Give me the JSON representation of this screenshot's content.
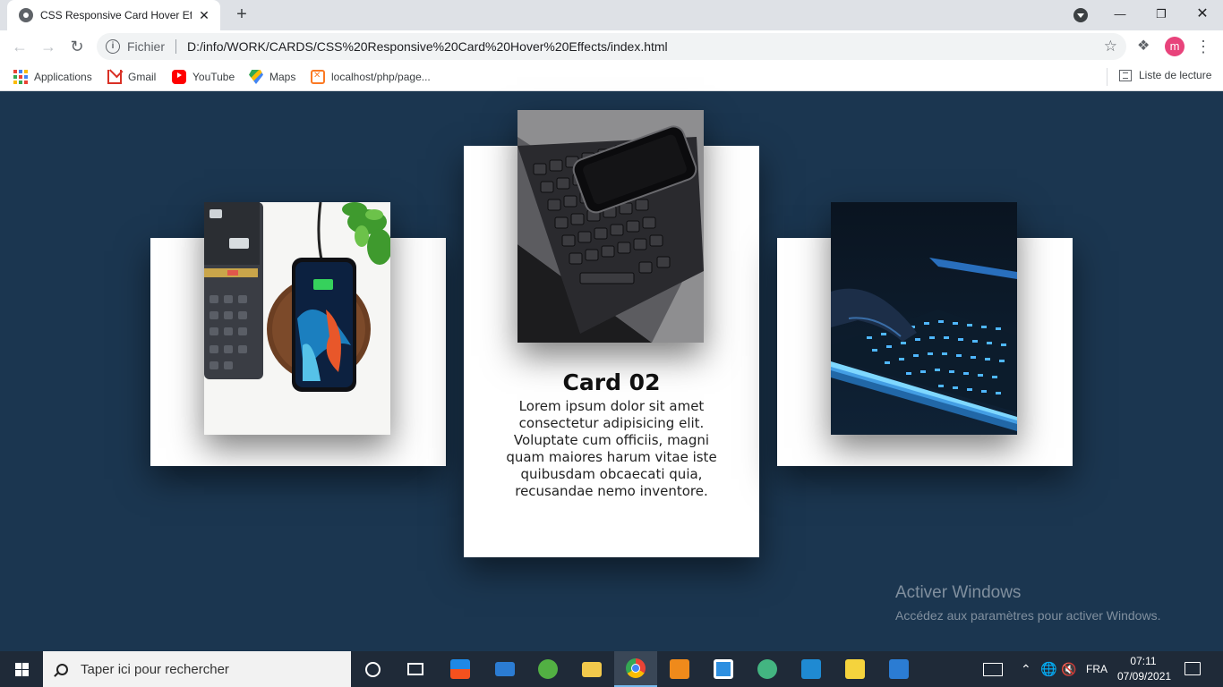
{
  "browser": {
    "tab_title": "CSS Responsive Card Hover Effects",
    "tab_close": "✕",
    "new_tab": "+",
    "url_scheme": "Fichier",
    "url": "D:/info/WORK/CARDS/CSS%20Responsive%20Card%20Hover%20Effects/index.html",
    "profile_initial": "m",
    "bookmarks": [
      {
        "label": "Applications",
        "icon": "apps-grid-icon"
      },
      {
        "label": "Gmail",
        "icon": "gmail-icon"
      },
      {
        "label": "YouTube",
        "icon": "youtube-icon"
      },
      {
        "label": "Maps",
        "icon": "maps-icon"
      },
      {
        "label": "localhost/php/page...",
        "icon": "xampp-icon"
      }
    ],
    "reading_list": "Liste de lecture"
  },
  "cards": [
    {
      "title": "",
      "text": "",
      "image": "phone-on-wireless-charger-photo"
    },
    {
      "title": "Card 02",
      "text": "Lorem ipsum dolor sit amet consectetur adipisicing elit. Voluptate cum officiis, magni quam maiores harum vitae iste quibusdam obcaecati quia, recusandae nemo inventore.",
      "image": "phone-on-laptop-keyboard-photo"
    },
    {
      "title": "",
      "text": "",
      "image": "backlit-keyboard-photo"
    }
  ],
  "colors": {
    "page_background": "#1b3650",
    "card_background": "#ffffff",
    "taskbar": "#1f2a38",
    "profile_avatar": "#e8437b"
  },
  "watermark": {
    "title": "Activer Windows",
    "subtitle": "Accédez aux paramètres pour activer Windows."
  },
  "taskbar": {
    "search_placeholder": "Taper ici pour rechercher",
    "language": "FRA",
    "time": "07:11",
    "date": "07/09/2021"
  }
}
